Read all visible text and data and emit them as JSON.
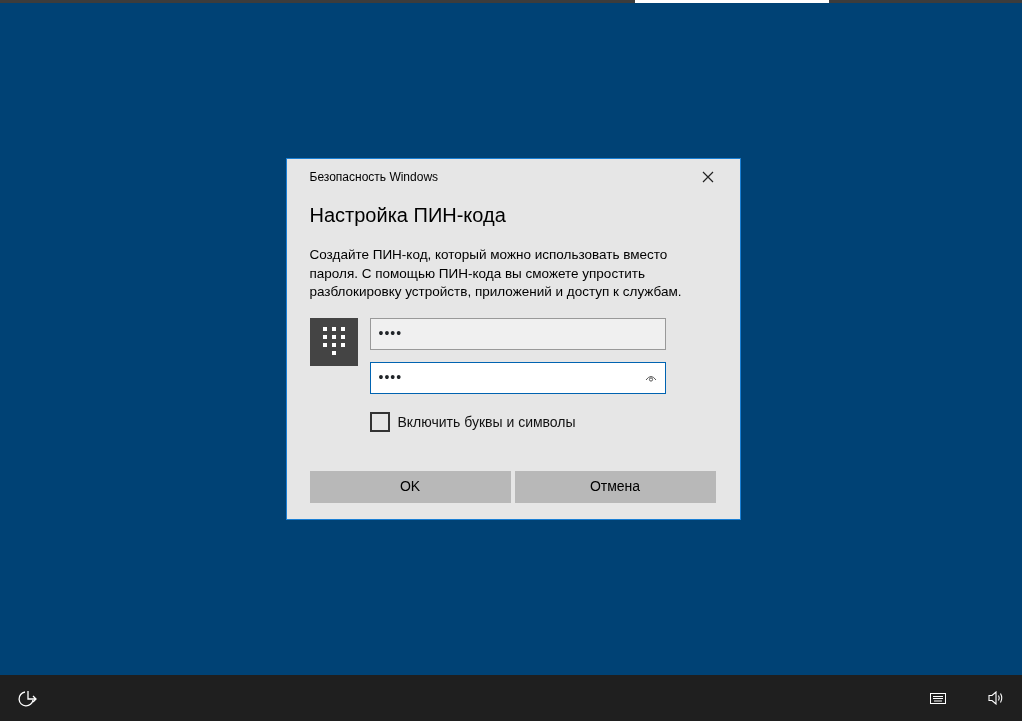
{
  "dialog": {
    "app_title": "Безопасность Windows",
    "title": "Настройка ПИН-кода",
    "description": "Создайте ПИН-код, который можно использовать вместо пароля. С помощью ПИН-кода вы сможете упростить разблокировку устройств, приложений и доступ к службам.",
    "fields": [
      {
        "value": "••••",
        "focused": false,
        "reveal": false
      },
      {
        "value": "••••",
        "focused": true,
        "reveal": true
      }
    ],
    "checkbox": {
      "label": "Включить буквы и символы",
      "checked": false
    },
    "buttons": [
      "OK",
      "Отмена"
    ]
  }
}
